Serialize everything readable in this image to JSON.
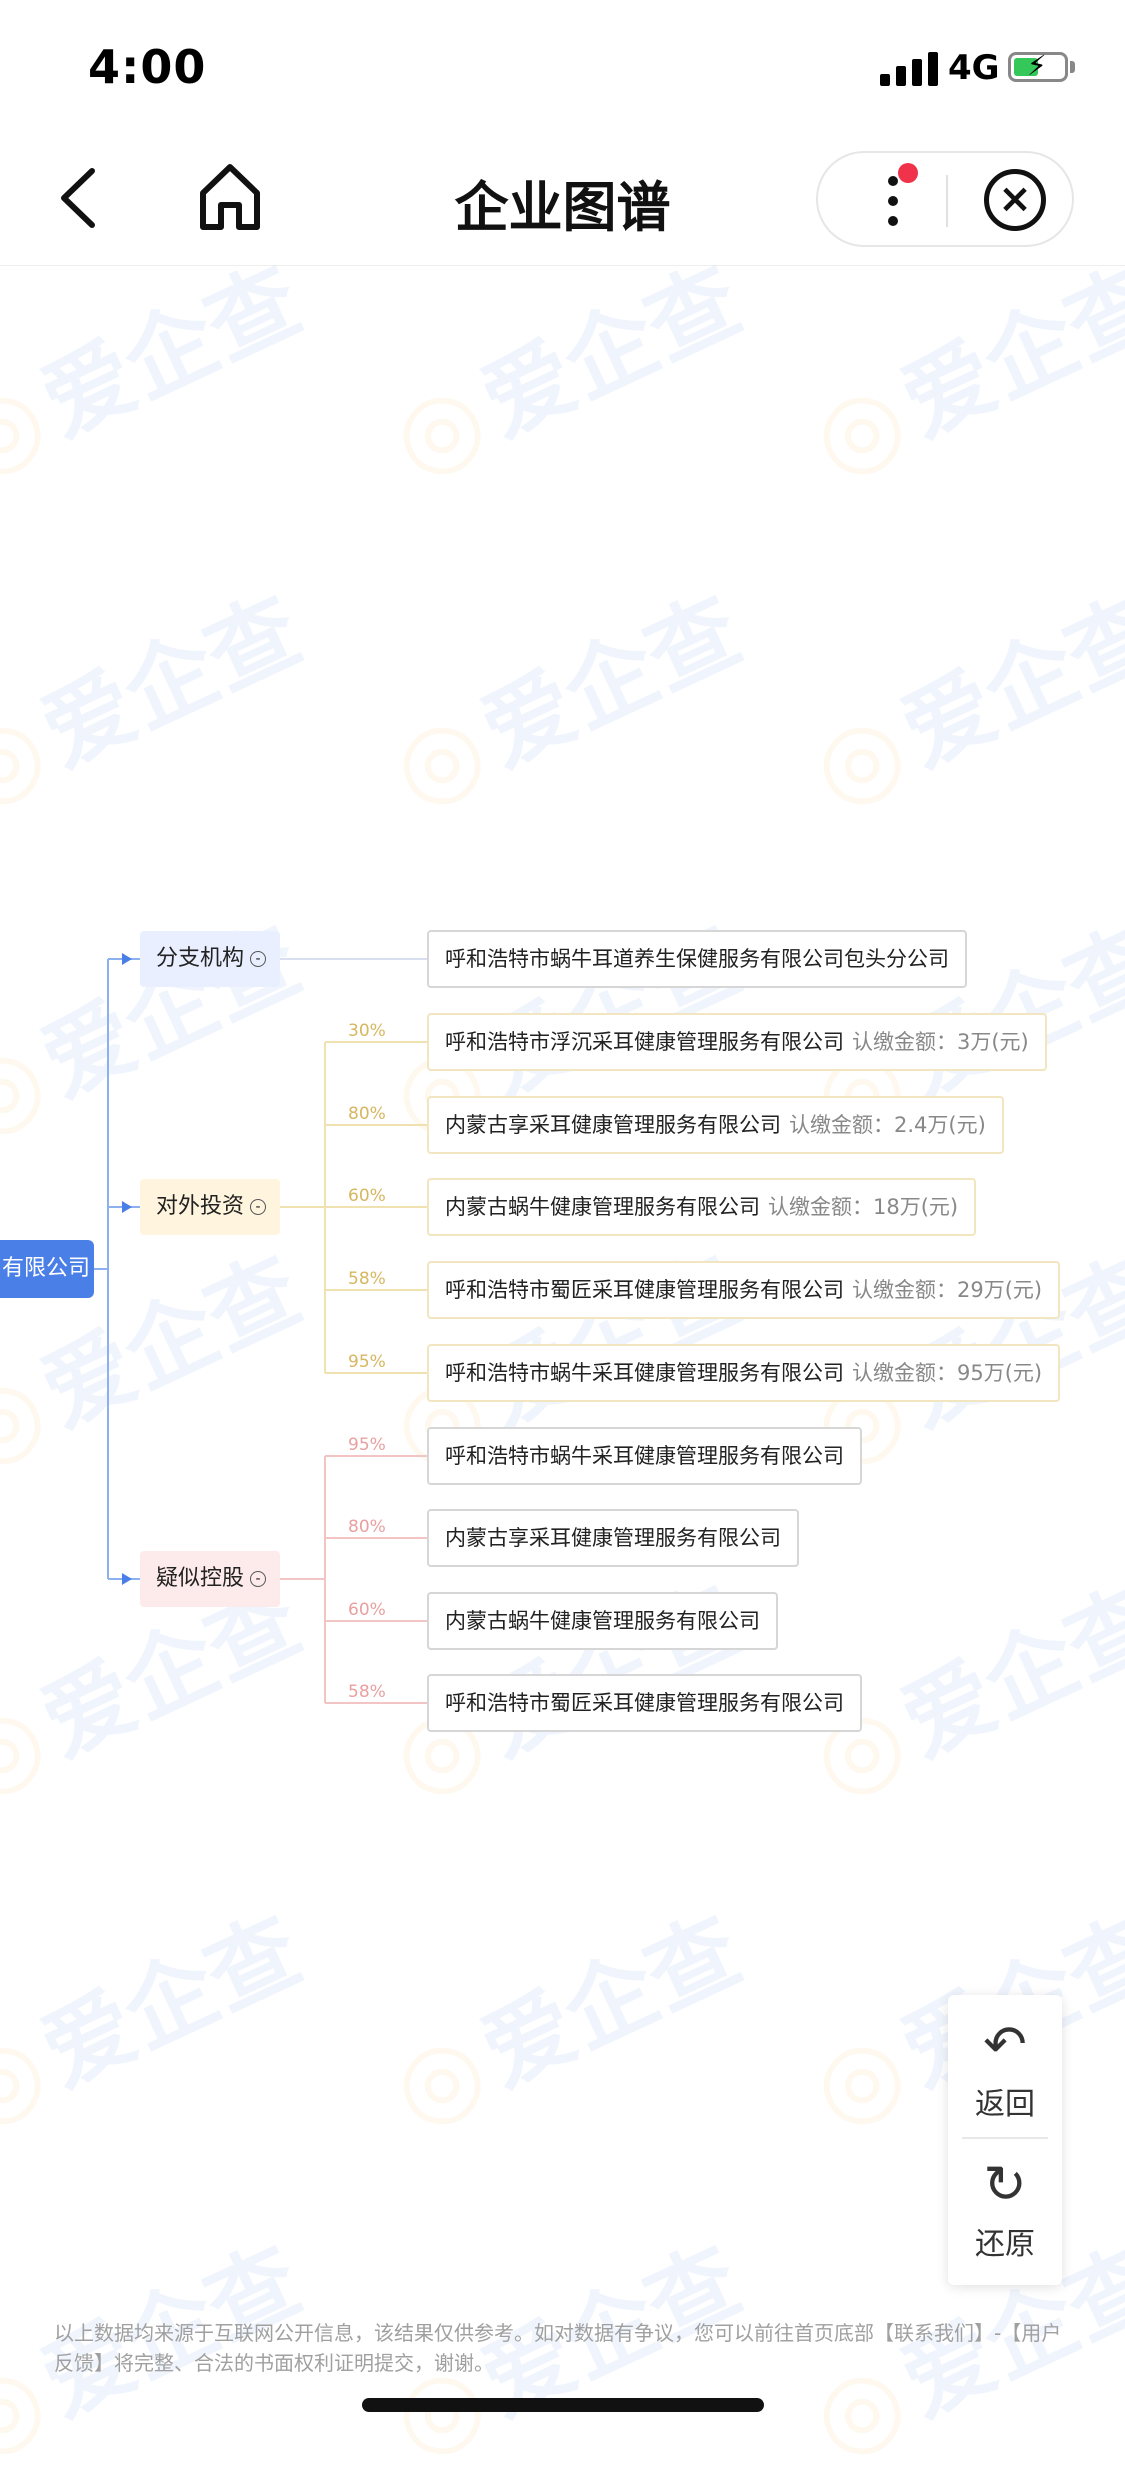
{
  "status_bar": {
    "time": "4:00",
    "network": "4G"
  },
  "nav": {
    "title": "企业图谱"
  },
  "graph": {
    "root_label": "有限公司",
    "categories": {
      "branch": "分支机构",
      "investment": "对外投资",
      "control": "疑似控股"
    },
    "branch_nodes": [
      {
        "name": "呼和浩特市蜗牛耳道养生保健服务有限公司包头分公司"
      }
    ],
    "investment_nodes": [
      {
        "pct": "30%",
        "name": "呼和浩特市浮沉采耳健康管理服务有限公司",
        "amount": "认缴金额：3万(元)"
      },
      {
        "pct": "80%",
        "name": "内蒙古享采耳健康管理服务有限公司",
        "amount": "认缴金额：2.4万(元)"
      },
      {
        "pct": "60%",
        "name": "内蒙古蜗牛健康管理服务有限公司",
        "amount": "认缴金额：18万(元)"
      },
      {
        "pct": "58%",
        "name": "呼和浩特市蜀匠采耳健康管理服务有限公司",
        "amount": "认缴金额：29万(元)"
      },
      {
        "pct": "95%",
        "name": "呼和浩特市蜗牛采耳健康管理服务有限公司",
        "amount": "认缴金额：95万(元)"
      }
    ],
    "control_nodes": [
      {
        "pct": "95%",
        "name": "呼和浩特市蜗牛采耳健康管理服务有限公司"
      },
      {
        "pct": "80%",
        "name": "内蒙古享采耳健康管理服务有限公司"
      },
      {
        "pct": "60%",
        "name": "内蒙古蜗牛健康管理服务有限公司"
      },
      {
        "pct": "58%",
        "name": "呼和浩特市蜀匠采耳健康管理服务有限公司"
      }
    ]
  },
  "tools": {
    "back_label": "返回",
    "reset_label": "还原"
  },
  "watermark": "爱企查",
  "footer": "以上数据均来源于互联网公开信息，该结果仅供参考。如对数据有争议，您可以前往首页底部【联系我们】-【用户反馈】将完整、合法的书面权利证明提交，谢谢。",
  "colors": {
    "root": "#4a7fe8",
    "branch_bg": "#e9efff",
    "invest_bg": "#fff4dd",
    "control_bg": "#fdeaea"
  }
}
